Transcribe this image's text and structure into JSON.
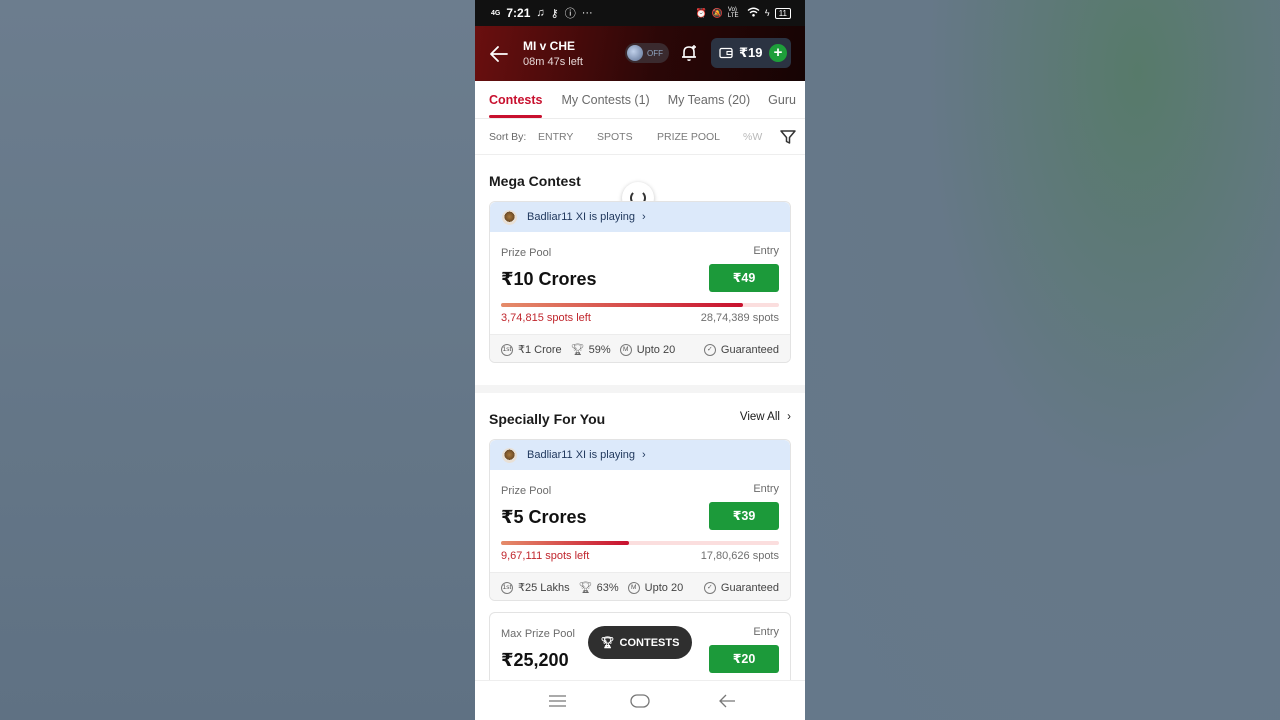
{
  "status_bar": {
    "network": "4G",
    "time": "7:21",
    "volte": "Vo) LTE",
    "battery": "11"
  },
  "header": {
    "match_title": "MI v CHE",
    "time_left": "08m 47s left",
    "toggle_label": "OFF",
    "wallet_amount": "₹19",
    "wallet_add": "+"
  },
  "tabs": [
    {
      "label": "Contests",
      "active": true
    },
    {
      "label": "My Contests (1)"
    },
    {
      "label": "My Teams (20)"
    },
    {
      "label": "Guru"
    }
  ],
  "sort_bar": {
    "label": "Sort By:",
    "options": [
      "ENTRY",
      "SPOTS",
      "PRIZE POOL",
      "%W"
    ]
  },
  "mega_contest": {
    "title": "Mega Contest",
    "playing_text": "Badliar11 XI is playing",
    "prize_pool_label": "Prize Pool",
    "prize_pool": "₹10 Crores",
    "entry_label": "Entry",
    "entry_fee": "₹49",
    "fill_fraction": 0.87,
    "spots_left": "3,74,815 spots left",
    "total_spots": "28,74,389 spots",
    "first_prize": "₹1 Crore",
    "win_percent": "59%",
    "max_entries": "Upto 20",
    "guarantee": "Guaranteed"
  },
  "specially_for_you": {
    "title": "Specially For You",
    "view_all": "View All",
    "contest_1": {
      "playing_text": "Badliar11 XI is playing",
      "prize_pool_label": "Prize Pool",
      "prize_pool": "₹5 Crores",
      "entry_label": "Entry",
      "entry_fee": "₹39",
      "fill_fraction": 0.46,
      "spots_left": "9,67,111 spots left",
      "total_spots": "17,80,626 spots",
      "first_prize": "₹25 Lakhs",
      "win_percent": "63%",
      "max_entries": "Upto 20",
      "guarantee": "Guaranteed"
    },
    "contest_2": {
      "prize_pool_label": "Max Prize Pool",
      "prize_pool": "₹25,200",
      "entry_label": "Entry",
      "entry_fee": "₹20"
    }
  },
  "fab": {
    "label": "CONTESTS"
  },
  "colors": {
    "accent": "#c8102e",
    "entry_green": "#1c9a3a",
    "header_red": "#6a0f0f"
  }
}
